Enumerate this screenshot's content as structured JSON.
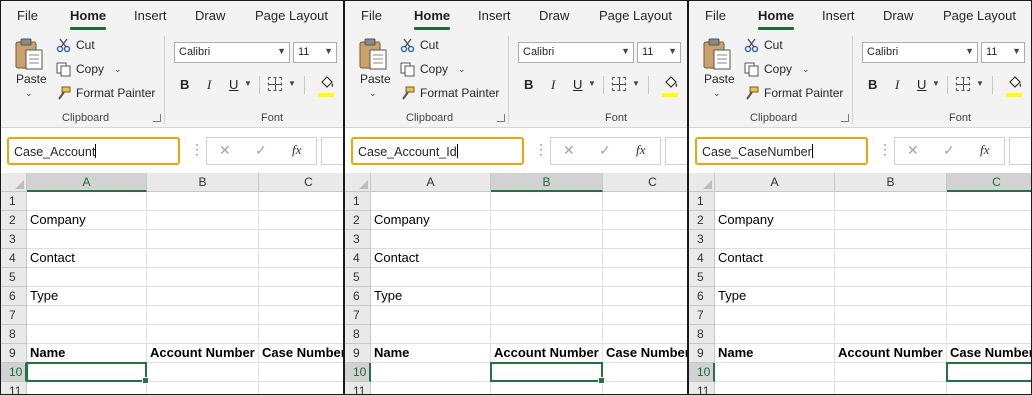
{
  "panels": [
    {
      "tabs": {
        "file": "File",
        "home": "Home",
        "insert": "Insert",
        "draw": "Draw",
        "page_layout": "Page Layout"
      },
      "clipboard": {
        "paste": "Paste",
        "cut": "Cut",
        "copy": "Copy",
        "format_painter": "Format Painter",
        "group_label": "Clipboard"
      },
      "font": {
        "name": "Calibri",
        "size": "11",
        "group_label": "Font",
        "bold": "B",
        "italic": "I",
        "underline": "U"
      },
      "name_box": "Case_Account",
      "selected_column": "A",
      "columns": [
        "A",
        "B",
        "C"
      ],
      "rows": [
        "1",
        "2",
        "3",
        "4",
        "5",
        "6",
        "7",
        "8",
        "9",
        "10",
        "11"
      ],
      "cells": {
        "a2": "Company",
        "a4": "Contact",
        "a6": "Type",
        "a9": "Name",
        "b9": "Account Number",
        "c9": "Case Number"
      }
    },
    {
      "tabs": {
        "file": "File",
        "home": "Home",
        "insert": "Insert",
        "draw": "Draw",
        "page_layout": "Page Layout"
      },
      "clipboard": {
        "paste": "Paste",
        "cut": "Cut",
        "copy": "Copy",
        "format_painter": "Format Painter",
        "group_label": "Clipboard"
      },
      "font": {
        "name": "Calibri",
        "size": "11",
        "group_label": "Font",
        "bold": "B",
        "italic": "I",
        "underline": "U"
      },
      "name_box": "Case_Account_Id",
      "selected_column": "B",
      "columns": [
        "A",
        "B",
        "C"
      ],
      "rows": [
        "1",
        "2",
        "3",
        "4",
        "5",
        "6",
        "7",
        "8",
        "9",
        "10",
        "11"
      ],
      "cells": {
        "a2": "Company",
        "a4": "Contact",
        "a6": "Type",
        "a9": "Name",
        "b9": "Account Number",
        "c9": "Case Number"
      }
    },
    {
      "tabs": {
        "file": "File",
        "home": "Home",
        "insert": "Insert",
        "draw": "Draw",
        "page_layout": "Page Layout"
      },
      "clipboard": {
        "paste": "Paste",
        "cut": "Cut",
        "copy": "Copy",
        "format_painter": "Format Painter",
        "group_label": "Clipboard"
      },
      "font": {
        "name": "Calibri",
        "size": "11",
        "group_label": "Font",
        "bold": "B",
        "italic": "I",
        "underline": "U"
      },
      "name_box": "Case_CaseNumber",
      "selected_column": "C",
      "columns": [
        "A",
        "B",
        "C"
      ],
      "rows": [
        "1",
        "2",
        "3",
        "4",
        "5",
        "6",
        "7",
        "8",
        "9",
        "10",
        "11"
      ],
      "cells": {
        "a2": "Company",
        "a4": "Contact",
        "a6": "Type",
        "a9": "Name",
        "b9": "Account Number",
        "c9": "Case Number"
      }
    }
  ],
  "colors": {
    "accent_green": "#217346",
    "highlight_orange": "#f0a30a",
    "fill_yellow": "#ffff00"
  }
}
